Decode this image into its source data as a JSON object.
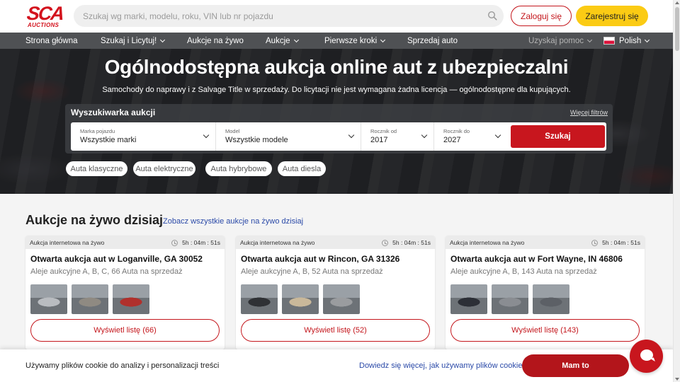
{
  "header": {
    "logo_top": "SCA",
    "logo_bottom": "AUCTIONS",
    "search_placeholder": "Szukaj wg marki, modelu, roku, VIN lub nr pojazdu",
    "login_label": "Zaloguj się",
    "register_label": "Zarejestruj się",
    "icons": {
      "search": "search-icon"
    }
  },
  "nav": {
    "items": [
      {
        "label": "Strona główna",
        "dropdown": false
      },
      {
        "label": "Szukaj i Licytuj!",
        "dropdown": true
      },
      {
        "label": "Aukcje na żywo",
        "dropdown": false
      },
      {
        "label": "Aukcje",
        "dropdown": true
      },
      {
        "label": "Pierwsze kroki",
        "dropdown": true
      },
      {
        "label": "Sprzedaj auto",
        "dropdown": false
      }
    ],
    "help_label": "Uzyskaj pomoc",
    "language_label": "Polish"
  },
  "hero": {
    "title": "Ogólnodostępna aukcja online aut z ubezpieczalni",
    "subtitle": "Samochody do naprawy i z Salvage Title w sprzedaży. Do licytacji nie jest wymagana żadna licencja — ogólnodostępne dla kupujących."
  },
  "finder": {
    "title": "Wyszukiwarka aukcji",
    "more_filters": "Więcej filtrów",
    "fields": [
      {
        "label": "Marka pojazdu",
        "value": "Wszystkie marki"
      },
      {
        "label": "Model",
        "value": "Wszystkie modele"
      },
      {
        "label": "Rocznik od",
        "value": "2017"
      },
      {
        "label": "Rocznik do",
        "value": "2027"
      }
    ],
    "search_label": "Szukaj"
  },
  "chips": [
    "Auta klasyczne",
    "Auta elektryczne",
    "Auta hybrybowe",
    "Auta diesla"
  ],
  "live": {
    "title": "Aukcje na żywo dzisiaj",
    "link": "Zobacz wszystkie aukcje na żywo dzisiaj",
    "cards": [
      {
        "type": "Aukcja internetowa na żywo",
        "timer": "5h : 04m : 51s",
        "title": "Otwarta aukcja aut w Loganville, GA 30052",
        "subtitle": "Aleje aukcyjne A, B, C, 66 Auta na sprzedaż",
        "button": "Wyświetl listę (66)",
        "thumb_colors": [
          "#b9bcc0",
          "#8f8a82",
          "#b0302c"
        ]
      },
      {
        "type": "Aukcja internetowa na żywo",
        "timer": "5h : 04m : 51s",
        "title": "Otwarta aukcja aut w Rincon, GA 31326",
        "subtitle": "Aleje aukcyjne A, B, 52 Auta na sprzedaż",
        "button": "Wyświetl listę (52)",
        "thumb_colors": [
          "#2f3135",
          "#c9b89a",
          "#9a9c9f"
        ]
      },
      {
        "type": "Aukcja internetowa na żywo",
        "timer": "5h : 04m : 51s",
        "title": "Otwarta aukcja aut w Fort Wayne, IN 46806",
        "subtitle": "Aleje aukcyjne A, B, 143 Auta na sprzedaż",
        "button": "Wyświetl listę (143)",
        "thumb_colors": [
          "#2c2f36",
          "#8a8d92",
          "#5c6066"
        ]
      }
    ]
  },
  "cookie": {
    "text": "Używamy plików cookie do analizy i personalizacji treści",
    "link": "Dowiedz się więcej, jak używamy plików cookie",
    "button": "Mam to"
  },
  "colors": {
    "brand_red": "#c8161e",
    "accent_yellow": "#fbcb14",
    "nav_bg": "#4f5154",
    "link_blue": "#2b4aa8"
  }
}
